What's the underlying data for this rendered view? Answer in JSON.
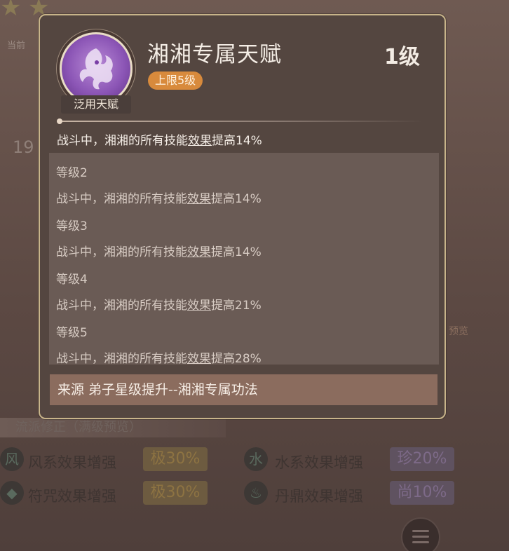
{
  "talent": {
    "name": "湘湘专属天赋",
    "level": "1级",
    "limit": "上限5级",
    "caption": "泛用天赋",
    "current_desc": {
      "pre": "战斗中，湘湘的所有技能",
      "u": "效果",
      "post": "提高14%"
    }
  },
  "levels": [
    {
      "name": "等级2",
      "pre": "战斗中，湘湘的所有技能",
      "u": "效果",
      "post": "提高14%"
    },
    {
      "name": "等级3",
      "pre": "战斗中，湘湘的所有技能",
      "u": "效果",
      "post": "提高14%"
    },
    {
      "name": "等级4",
      "pre": "战斗中，湘湘的所有技能",
      "u": "效果",
      "post": "提高21%"
    },
    {
      "name": "等级5",
      "pre": "战斗中，湘湘的所有技能",
      "u": "效果",
      "post": "提高28%"
    }
  ],
  "source": "来源  弟子星级提升--湘湘专属功法",
  "background": {
    "section_title": "流派修正（满级预览）",
    "stats": [
      {
        "icon": "风",
        "label": "风系效果增强",
        "value": "极30%",
        "tier": "gold"
      },
      {
        "icon": "水",
        "label": "水系效果增强",
        "value": "珍20%",
        "tier": "purple"
      },
      {
        "icon": "◆",
        "label": "符咒效果增强",
        "value": "极30%",
        "tier": "gold"
      },
      {
        "icon": "♨",
        "label": "丹鼎效果增强",
        "value": "尚10%",
        "tier": "purple"
      }
    ],
    "misc_texts": [
      "当前",
      "19",
      "预览"
    ]
  },
  "colors": {
    "frame_border": "#c8b48a",
    "badge": "#d88a3c",
    "icon_purple": "#8c56b6",
    "source_bar": "#8b6c5e"
  }
}
